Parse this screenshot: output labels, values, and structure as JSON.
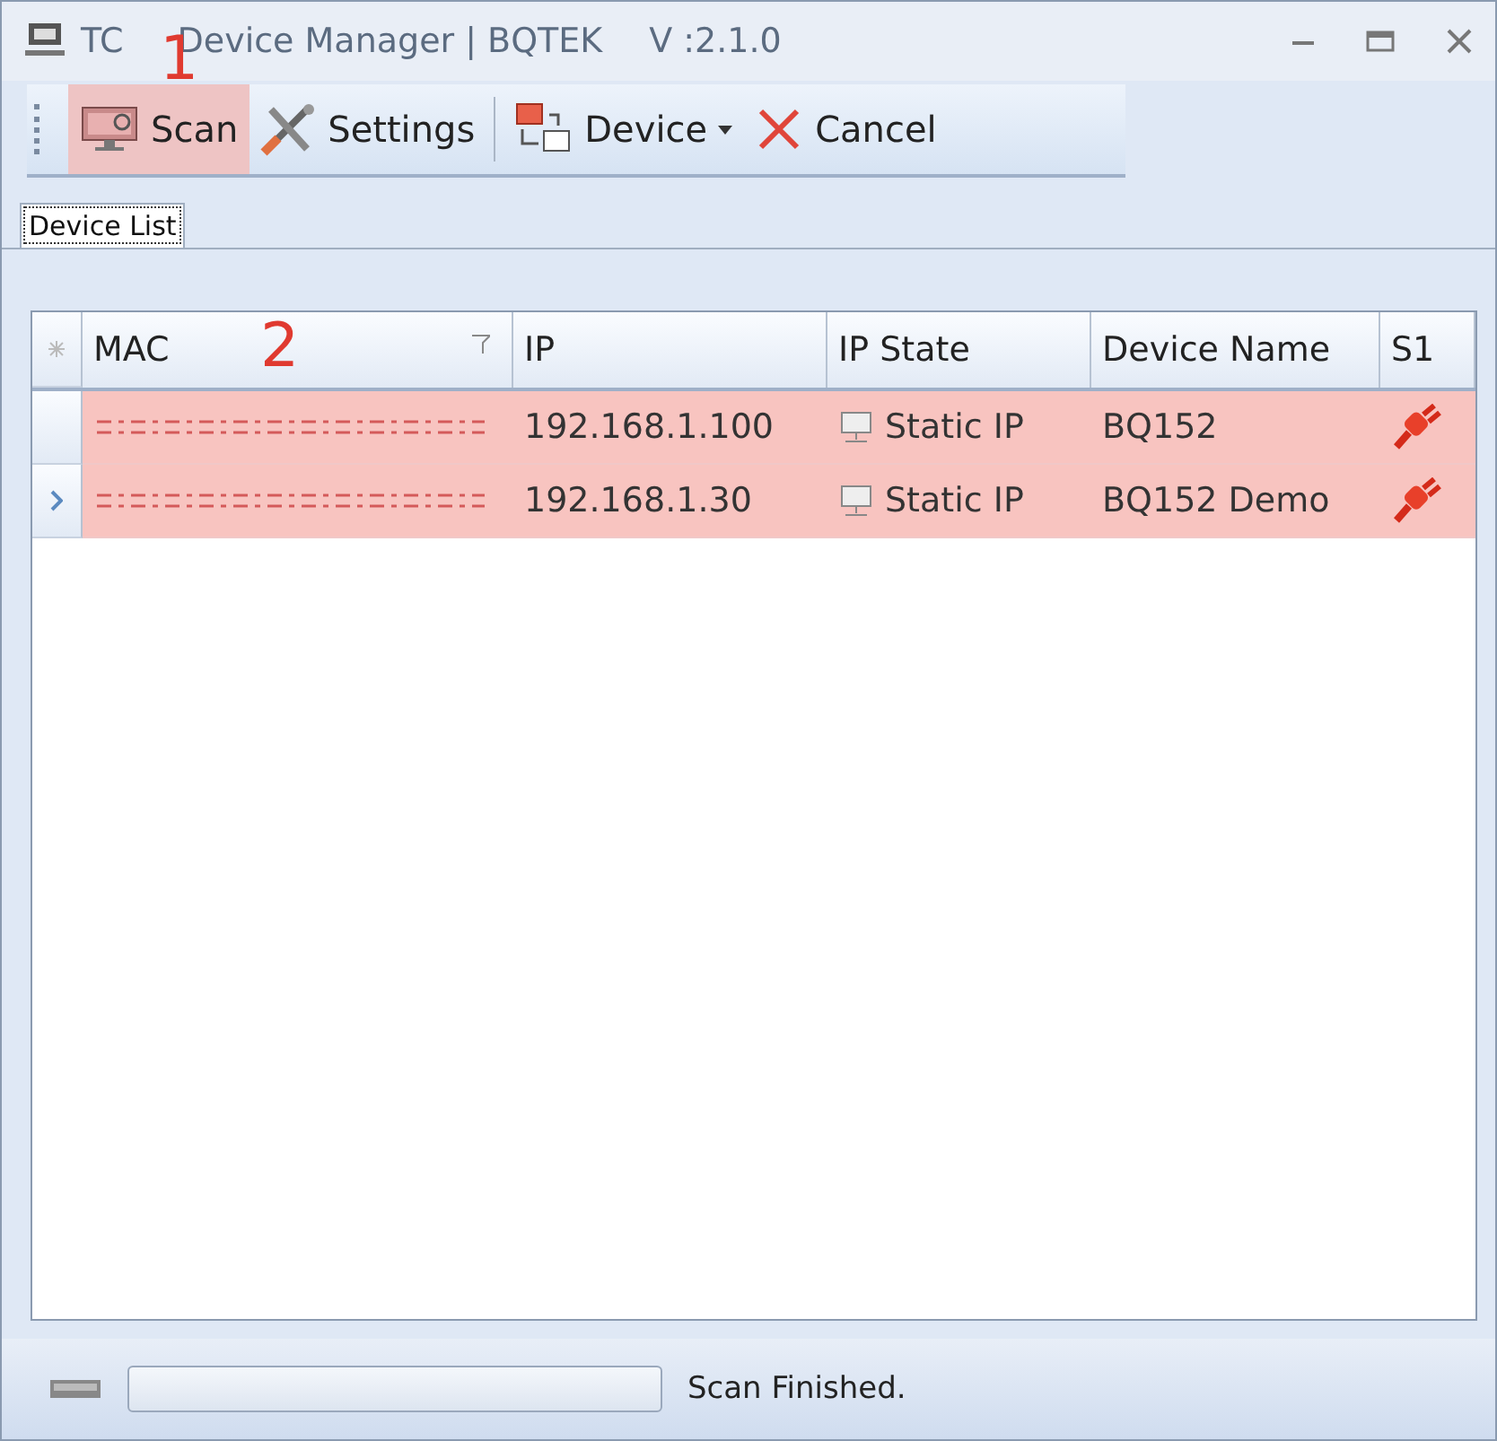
{
  "window": {
    "title_start": "TC",
    "title_rest": "Device Manager | BQTEK",
    "version": "V :2.1.0"
  },
  "annotations": [
    {
      "label": "1"
    },
    {
      "label": "2"
    }
  ],
  "toolbar": [
    {
      "kind": "scan",
      "label": "Scan",
      "selected": true,
      "dropdown": false
    },
    {
      "kind": "settings",
      "label": "Settings",
      "selected": false,
      "dropdown": false
    },
    {
      "kind": "device",
      "label": "Device",
      "selected": false,
      "dropdown": true
    },
    {
      "kind": "cancel",
      "label": "Cancel",
      "selected": false,
      "dropdown": false
    }
  ],
  "tabs": [
    {
      "label": "Device List",
      "selected": true
    }
  ],
  "table": {
    "columns": [
      "MAC",
      "IP",
      "IP State",
      "Device Name",
      "S1"
    ],
    "rows": [
      {
        "ip": "192.168.1.100",
        "ip_state": "Static IP",
        "device_name": "BQ152",
        "current": false,
        "highlighted": true
      },
      {
        "ip": "192.168.1.30",
        "ip_state": "Static IP",
        "device_name": "BQ152 Demo",
        "current": true,
        "highlighted": true
      }
    ]
  },
  "status_bar": {
    "level": 0,
    "message": "Scan Finished."
  }
}
